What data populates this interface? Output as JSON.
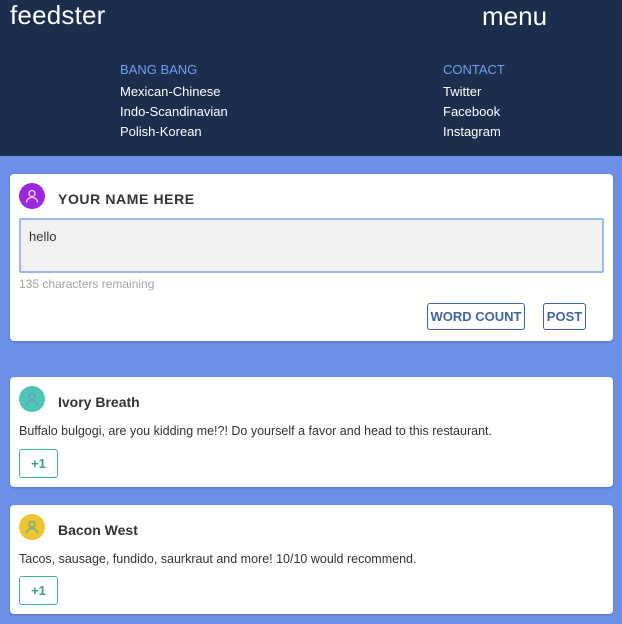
{
  "header": {
    "brand": "feedster",
    "menu_label": "menu",
    "columns": [
      {
        "heading": "BANG BANG",
        "links": [
          "Mexican-Chinese",
          "Indo-Scandinavian",
          "Polish-Korean"
        ]
      },
      {
        "heading": "CONTACT",
        "links": [
          "Twitter",
          "Facebook",
          "Instagram"
        ]
      }
    ]
  },
  "compose": {
    "name": "YOUR NAME HERE",
    "text": "hello",
    "remaining": "135 characters remaining",
    "word_count_label": "WORD COUNT",
    "post_label": "POST",
    "avatar_color": "#9c27e0"
  },
  "posts": [
    {
      "name": "Ivory Breath",
      "text": "Buffalo bulgogi, are you kidding me!?! Do yourself a favor and head to this restaurant.",
      "plus_label": "+1",
      "avatar_color": "#4dc7b4"
    },
    {
      "name": "Bacon West",
      "text": "Tacos, sausage, fundido, saurkraut and more! 10/10 would recommend.",
      "plus_label": "+1",
      "avatar_color": "#f0c330"
    }
  ],
  "colors": {
    "header_bg": "#1d2d4e",
    "page_bg": "#6d8fe8",
    "nav_heading": "#6fa1ee",
    "button_blue": "#3f63a8",
    "plus_green": "#2fa579"
  },
  "icons": {
    "avatar": "user-icon"
  }
}
